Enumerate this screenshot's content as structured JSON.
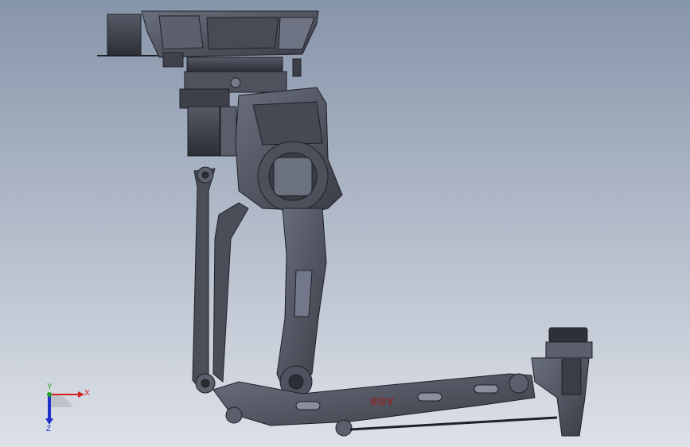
{
  "viewport": {
    "background_top": "#8795aa",
    "background_bottom": "#dde1e8"
  },
  "model": {
    "name": "robot-arm-assembly",
    "body_color": "#4a4e58",
    "edge_color": "#1e2026",
    "highlight_color": "#6c7180",
    "brand_text": "ABB",
    "brand_color": "#8a2a2a"
  },
  "triad": {
    "x_label": "X",
    "y_label": "Y",
    "z_label": "Z",
    "x_color": "#d62020",
    "y_color": "#20a020",
    "z_color": "#2030c8"
  }
}
